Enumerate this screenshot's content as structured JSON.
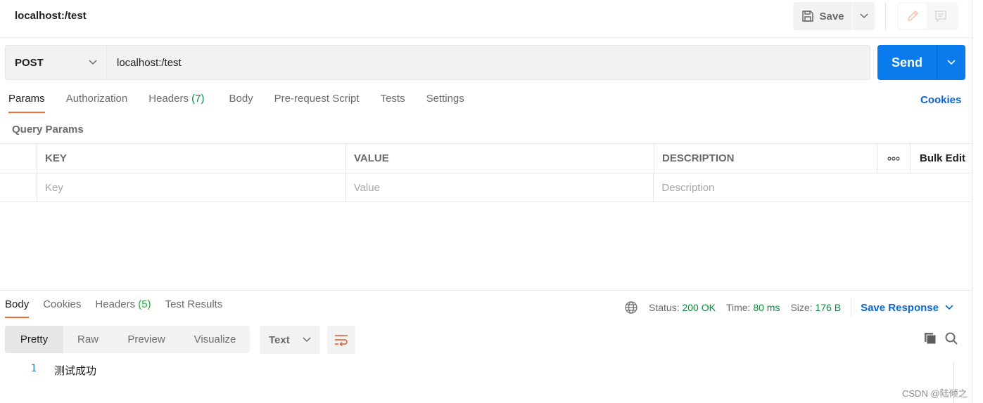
{
  "header": {
    "title": "localhost:/test",
    "save_label": "Save",
    "save_icon": "floppy-disk-icon",
    "mode_icons": [
      "pencil-icon",
      "comment-icon"
    ]
  },
  "request": {
    "method": "POST",
    "url": "localhost:/test",
    "send_label": "Send"
  },
  "request_tabs": [
    {
      "label": "Params",
      "count": "",
      "active": true
    },
    {
      "label": "Authorization",
      "count": ""
    },
    {
      "label": "Headers",
      "count": "(7)"
    },
    {
      "label": "Body",
      "count": ""
    },
    {
      "label": "Pre-request Script",
      "count": ""
    },
    {
      "label": "Tests",
      "count": ""
    },
    {
      "label": "Settings",
      "count": ""
    }
  ],
  "cookies_link": "Cookies",
  "query_params": {
    "title": "Query Params",
    "columns": [
      "KEY",
      "VALUE",
      "DESCRIPTION"
    ],
    "more_label": "ooo",
    "bulk_edit_label": "Bulk Edit",
    "placeholders": {
      "key": "Key",
      "value": "Value",
      "description": "Description"
    }
  },
  "response": {
    "tabs": [
      {
        "label": "Body",
        "count": "",
        "active": true
      },
      {
        "label": "Cookies",
        "count": ""
      },
      {
        "label": "Headers",
        "count": "(5)"
      },
      {
        "label": "Test Results",
        "count": ""
      }
    ],
    "status_label": "Status:",
    "status_value": "200 OK",
    "time_label": "Time:",
    "time_value": "80 ms",
    "size_label": "Size:",
    "size_value": "176 B",
    "save_response_label": "Save Response",
    "view_modes": [
      "Pretty",
      "Raw",
      "Preview",
      "Visualize"
    ],
    "active_view": "Pretty",
    "format": "Text",
    "lines": [
      {
        "number": "1",
        "text": "测试成功"
      }
    ]
  },
  "colors": {
    "accent_orange": "#f26b3a",
    "send_blue": "#097bed",
    "link_blue": "#0b66d4",
    "status_green": "#0a8a3a"
  },
  "watermark": "CSDN @陆倾之"
}
